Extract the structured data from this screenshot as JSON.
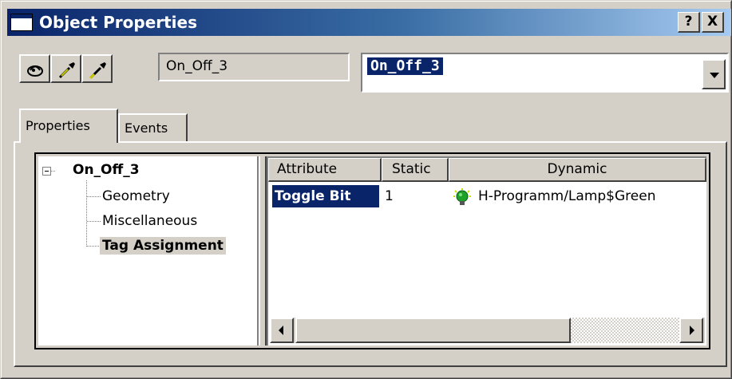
{
  "window": {
    "title": "Object Properties",
    "help_label": "?",
    "close_label": "X"
  },
  "toolbar": {
    "buttons": [
      {
        "icon": "pin-icon"
      },
      {
        "icon": "pick-format-icon"
      },
      {
        "icon": "apply-format-icon"
      }
    ],
    "object_name": "On_Off_3",
    "object_select": "On_Off_3"
  },
  "tabs": [
    {
      "label": "Properties",
      "active": true
    },
    {
      "label": "Events",
      "active": false
    }
  ],
  "tree": {
    "expander": "−",
    "root": "On_Off_3",
    "items": [
      {
        "label": "Geometry",
        "selected": false
      },
      {
        "label": "Miscellaneous",
        "selected": false
      },
      {
        "label": "Tag Assignment",
        "selected": true
      }
    ]
  },
  "grid": {
    "headers": [
      "Attribute",
      "Static",
      "Dynamic"
    ],
    "rows": [
      {
        "attribute": "Toggle Bit",
        "static": "1",
        "dynamic": "H-Programm/Lamp$Green",
        "dynamic_icon": "green-bulb-icon"
      }
    ]
  },
  "colors": {
    "titlebar_start": "#0a246a",
    "titlebar_end": "#a6caf0",
    "selection": "#0a246a",
    "face": "#d4d0c8",
    "bulb": "#1fa22a"
  }
}
